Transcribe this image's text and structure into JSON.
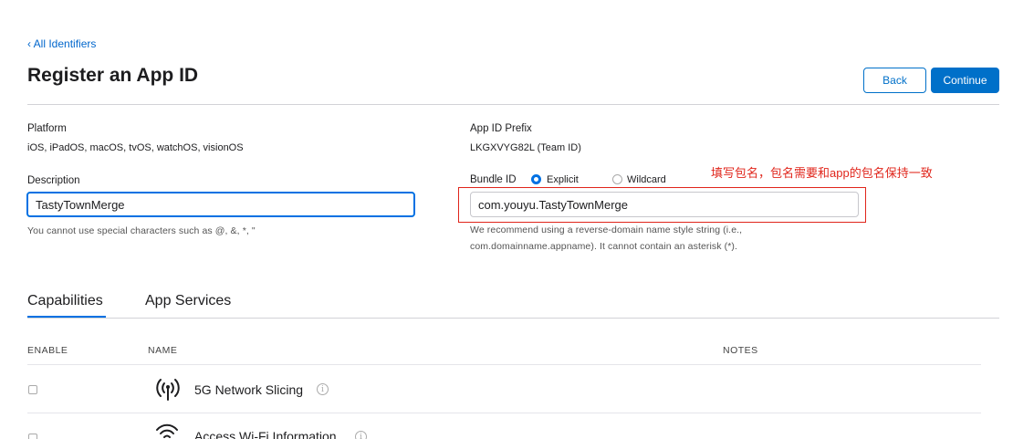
{
  "nav": {
    "back_link": "‹ All Identifiers"
  },
  "header": {
    "title": "Register an App ID",
    "back_button": "Back",
    "continue_button": "Continue"
  },
  "form": {
    "platform_label": "Platform",
    "platform_value": "iOS, iPadOS, macOS, tvOS, watchOS, visionOS",
    "prefix_label": "App ID Prefix",
    "prefix_value": "LKGXVYG82L (Team ID)",
    "description_label": "Description",
    "description_value": "TastyTownMerge",
    "description_help": "You cannot use special characters such as @, &, *, \"",
    "bundle_label": "Bundle ID",
    "radio_explicit": "Explicit",
    "radio_wildcard": "Wildcard",
    "bundle_value": "com.youyu.TastyTownMerge",
    "bundle_help_line1": "We recommend using a reverse-domain name style string (i.e.,",
    "bundle_help_line2": "com.domainname.appname). It cannot contain an asterisk (*)."
  },
  "annotation": {
    "text": "填写包名，包名需要和app的包名保持一致",
    "color": "#e0251b"
  },
  "tabs": [
    {
      "label": "Capabilities",
      "active": true
    },
    {
      "label": "App Services",
      "active": false
    }
  ],
  "table": {
    "headers": {
      "enable": "ENABLE",
      "name": "NAME",
      "notes": "NOTES"
    },
    "rows": [
      {
        "name": "5G Network Slicing",
        "icon": "antenna-signal-icon"
      },
      {
        "name": "Access Wi-Fi Information",
        "icon": "wifi-icon"
      }
    ]
  },
  "colors": {
    "accent": "#0070c9",
    "annotation": "#e0251b"
  }
}
